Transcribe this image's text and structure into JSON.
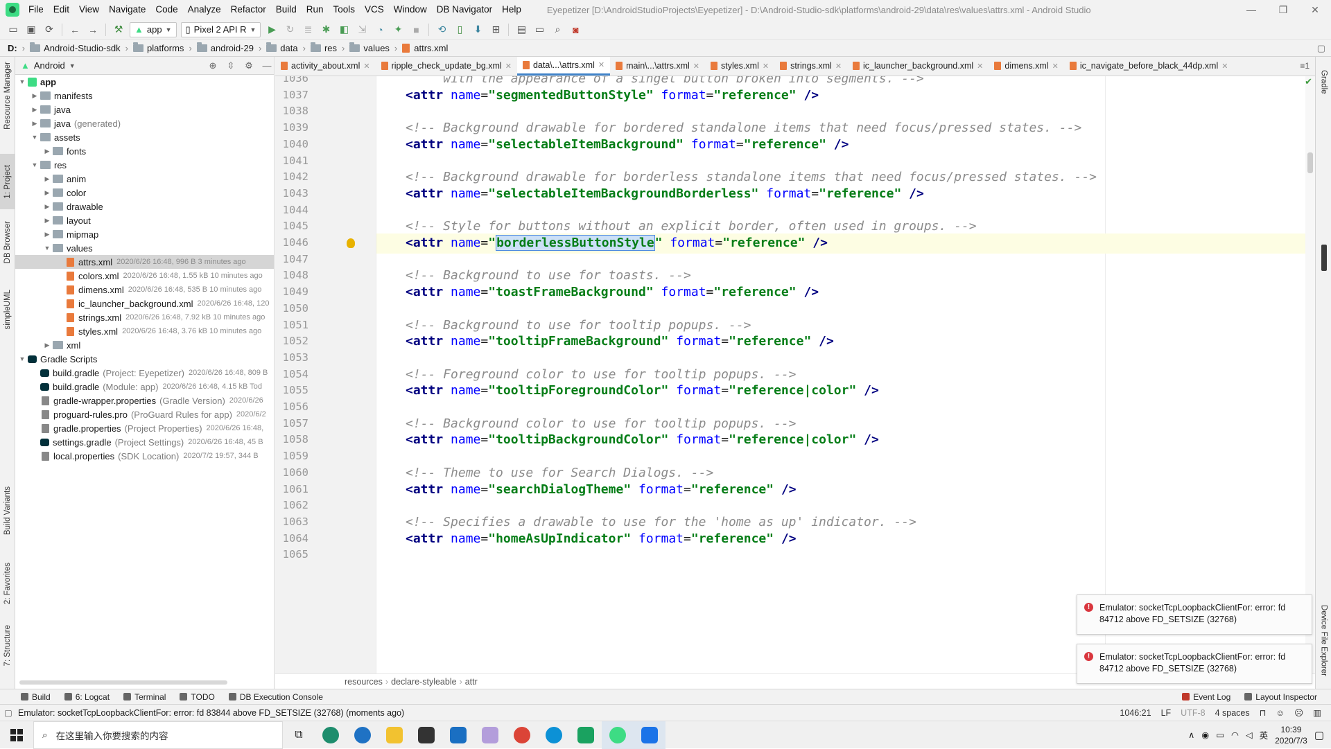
{
  "window": {
    "menus": [
      "File",
      "Edit",
      "View",
      "Navigate",
      "Code",
      "Analyze",
      "Refactor",
      "Build",
      "Run",
      "Tools",
      "VCS",
      "Window",
      "DB Navigator",
      "Help"
    ],
    "title": "Eyepetizer [D:\\AndroidStudioProjects\\Eyepetizer] - D:\\Android-Studio-sdk\\platforms\\android-29\\data\\res\\values\\attrs.xml - Android Studio"
  },
  "toolbar": {
    "run_config": "app",
    "device": "Pixel 2 API R"
  },
  "breadcrumb": [
    "D:",
    "Android-Studio-sdk",
    "platforms",
    "android-29",
    "data",
    "res",
    "values",
    "attrs.xml"
  ],
  "left_tabs": [
    "Resource Manager",
    "1: Project",
    "DB Browser",
    "simpleUML",
    "Build Variants",
    "2: Favorites",
    "7: Structure"
  ],
  "right_tabs": [
    "Gradle",
    "Device File Explorer"
  ],
  "project": {
    "view": "Android",
    "tree": [
      {
        "d": 0,
        "a": "▼",
        "i": "app",
        "label": "app",
        "bold": true
      },
      {
        "d": 1,
        "a": "▶",
        "i": "folder",
        "label": "manifests"
      },
      {
        "d": 1,
        "a": "▶",
        "i": "folder",
        "label": "java"
      },
      {
        "d": 1,
        "a": "▶",
        "i": "folder",
        "label": "java",
        "dim": "(generated)"
      },
      {
        "d": 1,
        "a": "▼",
        "i": "folder",
        "label": "assets"
      },
      {
        "d": 2,
        "a": "▶",
        "i": "folder",
        "label": "fonts"
      },
      {
        "d": 1,
        "a": "▼",
        "i": "folder",
        "label": "res"
      },
      {
        "d": 2,
        "a": "▶",
        "i": "folder",
        "label": "anim"
      },
      {
        "d": 2,
        "a": "▶",
        "i": "folder",
        "label": "color"
      },
      {
        "d": 2,
        "a": "▶",
        "i": "folder",
        "label": "drawable"
      },
      {
        "d": 2,
        "a": "▶",
        "i": "folder",
        "label": "layout"
      },
      {
        "d": 2,
        "a": "▶",
        "i": "folder",
        "label": "mipmap"
      },
      {
        "d": 2,
        "a": "▼",
        "i": "folder",
        "label": "values"
      },
      {
        "d": 3,
        "a": "",
        "i": "file",
        "label": "attrs.xml",
        "meta": "2020/6/26 16:48, 996 B 3 minutes ago",
        "sel": true
      },
      {
        "d": 3,
        "a": "",
        "i": "file",
        "label": "colors.xml",
        "meta": "2020/6/26 16:48, 1.55 kB 10 minutes ago"
      },
      {
        "d": 3,
        "a": "",
        "i": "file",
        "label": "dimens.xml",
        "meta": "2020/6/26 16:48, 535 B 10 minutes ago"
      },
      {
        "d": 3,
        "a": "",
        "i": "file",
        "label": "ic_launcher_background.xml",
        "meta": "2020/6/26 16:48, 120"
      },
      {
        "d": 3,
        "a": "",
        "i": "file",
        "label": "strings.xml",
        "meta": "2020/6/26 16:48, 7.92 kB 10 minutes ago"
      },
      {
        "d": 3,
        "a": "",
        "i": "file",
        "label": "styles.xml",
        "meta": "2020/6/26 16:48, 3.76 kB 10 minutes ago"
      },
      {
        "d": 2,
        "a": "▶",
        "i": "folder",
        "label": "xml"
      },
      {
        "d": 0,
        "a": "▼",
        "i": "gradle",
        "label": "Gradle Scripts"
      },
      {
        "d": 1,
        "a": "",
        "i": "gradle",
        "label": "build.gradle",
        "dim": "(Project: Eyepetizer)",
        "meta": "2020/6/26 16:48, 809 B"
      },
      {
        "d": 1,
        "a": "",
        "i": "gradle",
        "label": "build.gradle",
        "dim": "(Module: app)",
        "meta": "2020/6/26 16:48, 4.15 kB Tod"
      },
      {
        "d": 1,
        "a": "",
        "i": "prop",
        "label": "gradle-wrapper.properties",
        "dim": "(Gradle Version)",
        "meta": "2020/6/26"
      },
      {
        "d": 1,
        "a": "",
        "i": "prop",
        "label": "proguard-rules.pro",
        "dim": "(ProGuard Rules for app)",
        "meta": "2020/6/2"
      },
      {
        "d": 1,
        "a": "",
        "i": "prop",
        "label": "gradle.properties",
        "dim": "(Project Properties)",
        "meta": "2020/6/26 16:48,"
      },
      {
        "d": 1,
        "a": "",
        "i": "gradle",
        "label": "settings.gradle",
        "dim": "(Project Settings)",
        "meta": "2020/6/26 16:48, 45 B"
      },
      {
        "d": 1,
        "a": "",
        "i": "prop",
        "label": "local.properties",
        "dim": "(SDK Location)",
        "meta": "2020/7/2 19:57, 344 B"
      }
    ]
  },
  "tabs": [
    {
      "label": "activity_about.xml"
    },
    {
      "label": "ripple_check_update_bg.xml"
    },
    {
      "label": "data\\...\\attrs.xml",
      "active": true
    },
    {
      "label": "main\\...\\attrs.xml"
    },
    {
      "label": "styles.xml"
    },
    {
      "label": "strings.xml"
    },
    {
      "label": "ic_launcher_background.xml"
    },
    {
      "label": "dimens.xml"
    },
    {
      "label": "ic_navigate_before_black_44dp.xml"
    }
  ],
  "tabs_overflow": "≡1",
  "editor": {
    "current_line": 1046,
    "selected_name": "borderlessButtonStyle",
    "lines": [
      {
        "n": 1036,
        "t": "c",
        "text": "     with the appearance of a singel button broken into segments. -->"
      },
      {
        "n": 1037,
        "t": "a",
        "name": "segmentedButtonStyle",
        "format": "reference"
      },
      {
        "n": 1038,
        "t": "e"
      },
      {
        "n": 1039,
        "t": "c",
        "text": "<!-- Background drawable for bordered standalone items that need focus/pressed states. -->"
      },
      {
        "n": 1040,
        "t": "a",
        "name": "selectableItemBackground",
        "format": "reference"
      },
      {
        "n": 1041,
        "t": "e"
      },
      {
        "n": 1042,
        "t": "c",
        "text": "<!-- Background drawable for borderless standalone items that need focus/pressed states. -->"
      },
      {
        "n": 1043,
        "t": "a",
        "name": "selectableItemBackgroundBorderless",
        "format": "reference"
      },
      {
        "n": 1044,
        "t": "e"
      },
      {
        "n": 1045,
        "t": "c",
        "text": "<!-- Style for buttons without an explicit border, often used in groups. -->"
      },
      {
        "n": 1046,
        "t": "a",
        "name": "borderlessButtonStyle",
        "format": "reference",
        "cur": true
      },
      {
        "n": 1047,
        "t": "e"
      },
      {
        "n": 1048,
        "t": "c",
        "text": "<!-- Background to use for toasts. -->"
      },
      {
        "n": 1049,
        "t": "a",
        "name": "toastFrameBackground",
        "format": "reference"
      },
      {
        "n": 1050,
        "t": "e"
      },
      {
        "n": 1051,
        "t": "c",
        "text": "<!-- Background to use for tooltip popups. -->"
      },
      {
        "n": 1052,
        "t": "a",
        "name": "tooltipFrameBackground",
        "format": "reference"
      },
      {
        "n": 1053,
        "t": "e"
      },
      {
        "n": 1054,
        "t": "c",
        "text": "<!-- Foreground color to use for tooltip popups. -->"
      },
      {
        "n": 1055,
        "t": "a",
        "name": "tooltipForegroundColor",
        "format": "reference|color"
      },
      {
        "n": 1056,
        "t": "e"
      },
      {
        "n": 1057,
        "t": "c",
        "text": "<!-- Background color to use for tooltip popups. -->"
      },
      {
        "n": 1058,
        "t": "a",
        "name": "tooltipBackgroundColor",
        "format": "reference|color"
      },
      {
        "n": 1059,
        "t": "e"
      },
      {
        "n": 1060,
        "t": "c",
        "text": "<!-- Theme to use for Search Dialogs. -->"
      },
      {
        "n": 1061,
        "t": "a",
        "name": "searchDialogTheme",
        "format": "reference"
      },
      {
        "n": 1062,
        "t": "e"
      },
      {
        "n": 1063,
        "t": "c",
        "text": "<!-- Specifies a drawable to use for the 'home as up' indicator. -->"
      },
      {
        "n": 1064,
        "t": "a",
        "name": "homeAsUpIndicator",
        "format": "reference"
      },
      {
        "n": 1065,
        "t": "e"
      }
    ]
  },
  "editor_breadcrumb": [
    "resources",
    "declare-styleable",
    "attr"
  ],
  "notifications": [
    {
      "text": "Emulator: socketTcpLoopbackClientFor: error: fd 84712 above FD_SETSIZE (32768)"
    },
    {
      "text": "Emulator: socketTcpLoopbackClientFor: error: fd 84712 above FD_SETSIZE (32768)"
    }
  ],
  "bottom_tabs": {
    "left": [
      "Build",
      "6: Logcat",
      "Terminal",
      "TODO",
      "DB Execution Console"
    ],
    "right": [
      "Event Log",
      "Layout Inspector"
    ]
  },
  "status": {
    "message": "Emulator: socketTcpLoopbackClientFor: error: fd 83844 above FD_SETSIZE (32768) (moments ago)",
    "position": "1046:21",
    "line_sep": "LF",
    "encoding": "UTF-8",
    "indent": "4 spaces"
  },
  "taskbar": {
    "search_placeholder": "在这里输入你要搜索的内容",
    "ime": "英",
    "time": "10:39",
    "date": "2020/7/3"
  }
}
